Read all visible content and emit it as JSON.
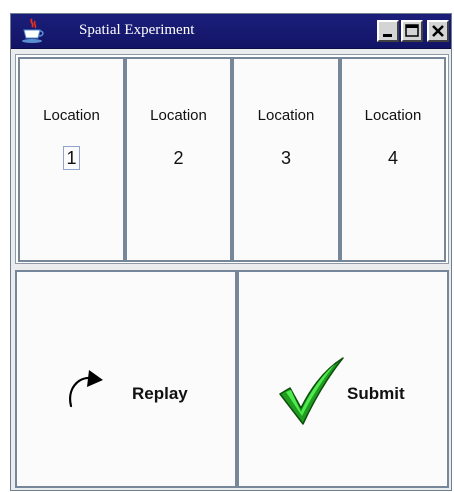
{
  "window": {
    "title": "Spatial Experiment",
    "icons": {
      "app": "java-cup-icon",
      "minimize": "minimize-icon",
      "maximize": "maximize-icon",
      "close": "close-icon"
    }
  },
  "locations": [
    {
      "label": "Location",
      "number": "1",
      "focused": true
    },
    {
      "label": "Location",
      "number": "2",
      "focused": false
    },
    {
      "label": "Location",
      "number": "3",
      "focused": false
    },
    {
      "label": "Location",
      "number": "4",
      "focused": false
    }
  ],
  "actions": {
    "replay": {
      "label": "Replay",
      "icon": "replay-arrow-icon"
    },
    "submit": {
      "label": "Submit",
      "icon": "checkmark-icon"
    }
  },
  "colors": {
    "titlebar": "#1b1f7a",
    "cell_border": "#76879a",
    "checkmark_green": "#2bd12b"
  }
}
